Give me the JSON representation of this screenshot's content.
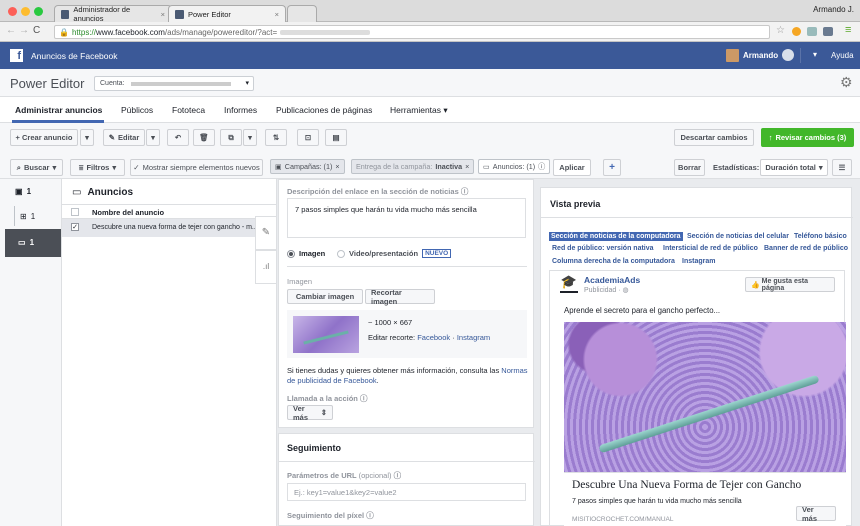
{
  "browser": {
    "tabs": [
      {
        "label": "Administrador de anuncios"
      },
      {
        "label": "Power Editor"
      }
    ],
    "profile": "Armando J.",
    "url_secure": "https://",
    "url_domain": "www.facebook.com",
    "url_path": "/ads/manage/powereditor/?act="
  },
  "fbbar": {
    "title": "Anuncios de Facebook",
    "user": "Armando",
    "help": "Ayuda"
  },
  "header": {
    "app_title": "Power Editor",
    "account_label": "Cuenta:"
  },
  "nav": {
    "items": [
      "Administrar anuncios",
      "Públicos",
      "Fototeca",
      "Informes",
      "Publicaciones de páginas",
      "Herramientas"
    ]
  },
  "toolbar": {
    "create": "+ Crear anuncio",
    "edit": "Editar",
    "discard": "Descartar cambios",
    "review": "Revisar cambios (3)"
  },
  "filters": {
    "search": "Buscar",
    "filters": "Filtros",
    "show_new": "Mostrar siempre elementos nuevos",
    "campaigns_chip": "Campañas: (1)",
    "delivery_chip_label": "Entrega de la campaña:",
    "delivery_chip_value": "Inactiva",
    "ads_chip": "Anuncios: (1)",
    "apply": "Aplicar",
    "clear": "Borrar",
    "stats_label": "Estadísticas:",
    "stats_value": "Duración total"
  },
  "tree": {
    "campaign_count": "1",
    "adset_count": "1",
    "ad_count": "1"
  },
  "list": {
    "title": "Anuncios",
    "column": "Nombre del anuncio",
    "rows": [
      "Descubre una nueva forma de tejer con gancho - m..."
    ]
  },
  "editor": {
    "link_desc_label": "Descripción del enlace en la sección de noticias",
    "link_desc_value": "7 pasos simples que harán tu vida mucho más sencilla",
    "radio_image": "Imagen",
    "radio_video": "Video/presentación",
    "new_badge": "NUEVO",
    "image_label": "Imagen",
    "change_image": "Cambiar imagen",
    "crop_image": "Recortar imagen",
    "dims": "~ 1000 × 667",
    "edit_crop_prefix": "Editar recorte:",
    "edit_crop_fb": "Facebook",
    "edit_crop_ig": "Instagram",
    "policy_text": "Si tienes dudas y quieres obtener más información, consulta las",
    "policy_link": "Normas de publicidad de Facebook",
    "cta_label": "Llamada a la acción",
    "cta_value": "Ver más",
    "tracking_title": "Seguimiento",
    "url_params_label": "Parámetros de URL",
    "url_params_optional": "(opcional)",
    "url_params_placeholder": "Ej.: key1=value1&key2=value2",
    "pixel_label": "Seguimiento del píxel"
  },
  "preview": {
    "title": "Vista previa",
    "placements": [
      "Sección de noticias de la computadora",
      "Sección de noticias del celular",
      "Teléfono básico",
      "Red de público: versión nativa",
      "Intersticial de red de público",
      "Banner de red de público",
      "Columna derecha de la computadora",
      "Instagram"
    ],
    "page_name": "AcademiaAds",
    "sponsored": "Publicidad",
    "like_button": "Me gusta esta página",
    "post_text": "Aprende el secreto para el gancho perfecto...",
    "headline": "Descubre Una Nueva Forma de Tejer con Gancho",
    "description": "7 pasos simples que harán tu vida mucho más sencilla",
    "domain": "MISITIOCROCHET.COM/MANUAL",
    "cta": "Ver más"
  },
  "colors": {
    "fb_blue": "#3b5998",
    "green": "#42b72a",
    "link": "#365899"
  }
}
